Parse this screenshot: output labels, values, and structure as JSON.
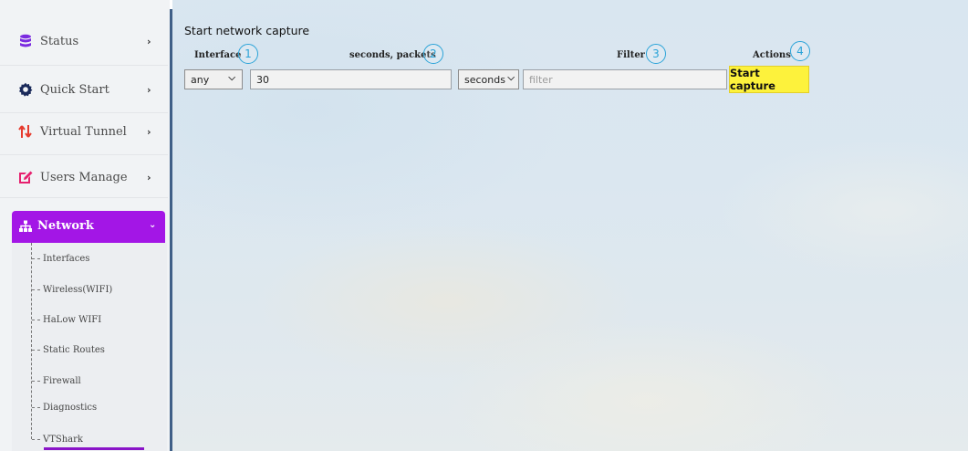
{
  "sidebar": {
    "items": [
      {
        "label": "Status",
        "icon": "database-icon"
      },
      {
        "label": "Quick Start",
        "icon": "gear-icon"
      },
      {
        "label": "Virtual Tunnel",
        "icon": "transfer-arrows-icon"
      },
      {
        "label": "Users Manage",
        "icon": "edit-icon"
      }
    ],
    "active": {
      "label": "Network",
      "icon": "sitemap-icon"
    },
    "submenu": [
      "Interfaces",
      "Wireless(WIFI)",
      "HaLow WIFI",
      "Static Routes",
      "Firewall",
      "Diagnostics",
      "VTShark"
    ],
    "accent_color": "#a316e6"
  },
  "main": {
    "title": "Start network capture",
    "columns": {
      "interface": "Interface",
      "duration": "seconds, packets",
      "filter": "Filter",
      "actions": "Actions"
    },
    "badges": [
      "1",
      "2",
      "3",
      "4"
    ],
    "badge_color": "#2aa3d8",
    "interface_select": "any",
    "duration_value": "30",
    "unit_select": "seconds",
    "filter_placeholder": "filter",
    "start_button": "Start capture",
    "button_color": "#fdf23c"
  }
}
